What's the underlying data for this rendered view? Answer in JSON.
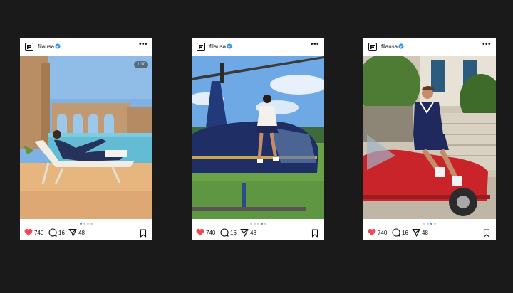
{
  "posts": [
    {
      "username": "filausa",
      "counter": "1/10",
      "likes": "740",
      "comments": "16",
      "shares": "48"
    },
    {
      "username": "filausa",
      "likes": "740",
      "comments": "16",
      "shares": "48"
    },
    {
      "username": "filausa",
      "likes": "740",
      "comments": "16",
      "shares": "48"
    }
  ],
  "icons": {
    "like": "heart-icon",
    "comment": "comment-icon",
    "share": "send-icon",
    "save": "bookmark-icon",
    "more": "more-icon",
    "verified": "verified-badge-icon"
  },
  "colors": {
    "like": "#ed4956",
    "accent": "#3897f0",
    "background": "#1a1a1a"
  }
}
